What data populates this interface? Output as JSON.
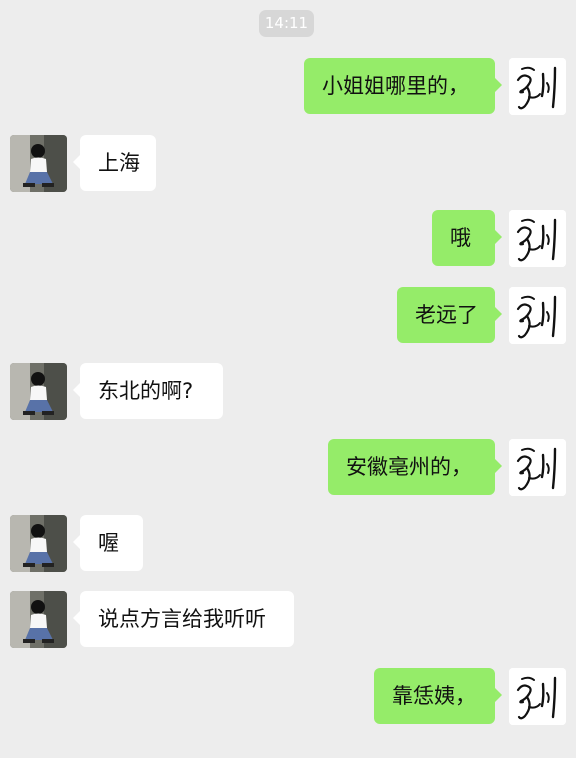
{
  "status": {
    "time": "14:11"
  },
  "conversation": {
    "messages": [
      {
        "sender": "me",
        "text": "小姐姐哪里的，"
      },
      {
        "sender": "other",
        "text": "上海"
      },
      {
        "sender": "me",
        "text": "哦"
      },
      {
        "sender": "me",
        "text": "老远了"
      },
      {
        "sender": "other",
        "text": "东北的啊?"
      },
      {
        "sender": "me",
        "text": "安徽亳州的，"
      },
      {
        "sender": "other",
        "text": "喔"
      },
      {
        "sender": "other",
        "text": "说点方言给我听听"
      },
      {
        "sender": "me",
        "text": "靠恁姨，"
      }
    ]
  },
  "icons": {
    "my_avatar": "signature-avatar-icon",
    "contact_avatar": "girl-photo-avatar"
  },
  "colors": {
    "background": "#ededed",
    "my_bubble": "#95ec69",
    "contact_bubble": "#ffffff",
    "timestamp_pill": "#d7d7d7"
  }
}
